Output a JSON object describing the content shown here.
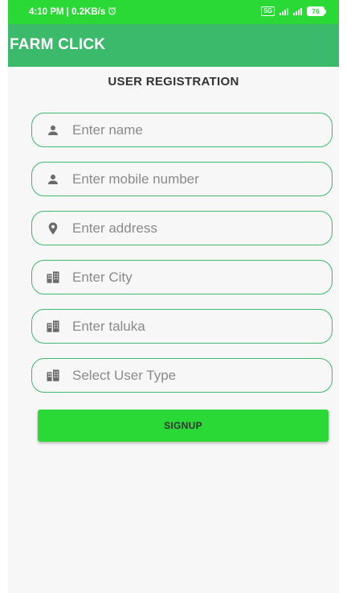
{
  "status_bar": {
    "time_info": "4:10 PM | 0.2KB/s",
    "alarm_icon": "alarm-clock-icon",
    "sim_label": "5G",
    "battery_level": "76"
  },
  "app_bar": {
    "title": "FARM CLICK"
  },
  "form": {
    "title": "USER REGISTRATION",
    "fields": [
      {
        "placeholder": "Enter name",
        "icon": "person-icon"
      },
      {
        "placeholder": "Enter mobile number",
        "icon": "person-icon"
      },
      {
        "placeholder": "Enter address",
        "icon": "location-pin-icon"
      },
      {
        "placeholder": "Enter City",
        "icon": "city-buildings-icon"
      },
      {
        "placeholder": "Enter taluka",
        "icon": "city-buildings-icon"
      },
      {
        "placeholder": "Select User Type",
        "icon": "city-buildings-icon"
      }
    ],
    "signup_label": "SIGNUP"
  },
  "colors": {
    "status_bar": "#2bd936",
    "app_bar": "#3bba6c",
    "field_border": "#3bba6c",
    "button": "#2bd936",
    "icon": "#6b6b6b",
    "background": "#f7f7f7"
  }
}
